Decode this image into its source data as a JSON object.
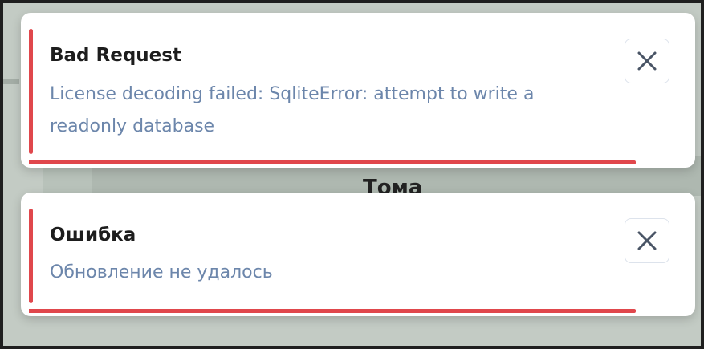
{
  "background": {
    "heading": "Тома"
  },
  "toasts": [
    {
      "title": "Bad Request",
      "message": "License decoding failed: SqliteError: attempt to write a readonly database",
      "close_icon": "close-icon",
      "progress": 0.9,
      "accent_color": "#e0474c"
    },
    {
      "title": "Ошибка",
      "message": "Обновление не удалось",
      "close_icon": "close-icon",
      "progress": 0.9,
      "accent_color": "#e0474c"
    }
  ],
  "colors": {
    "title": "#1d1d1d",
    "message": "#6c86ab",
    "accent": "#e0474c",
    "overlay": "#c3cbc4"
  }
}
